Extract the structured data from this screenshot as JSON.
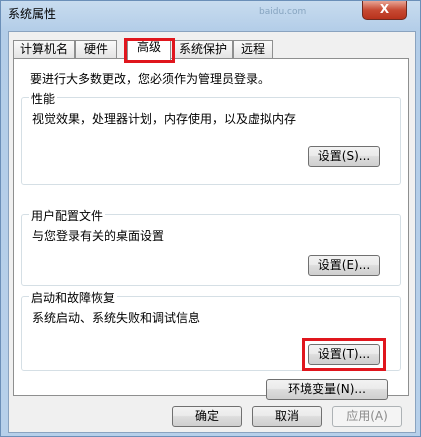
{
  "window": {
    "title": "系统属性",
    "close_label": "X",
    "watermark": "baidu.com"
  },
  "tabs": [
    {
      "label": "计算机名",
      "active": false
    },
    {
      "label": "硬件",
      "active": false
    },
    {
      "label": "高级",
      "active": true
    },
    {
      "label": "系统保护",
      "active": false
    },
    {
      "label": "远程",
      "active": false
    }
  ],
  "advanced": {
    "admin_note": "要进行大多数更改，您必须作为管理员登录。",
    "performance": {
      "title": "性能",
      "description": "视觉效果，处理器计划，内存使用，以及虚拟内存",
      "button": "设置(S)..."
    },
    "user_profiles": {
      "title": "用户配置文件",
      "description": "与您登录有关的桌面设置",
      "button": "设置(E)..."
    },
    "startup_recovery": {
      "title": "启动和故障恢复",
      "description": "系统启动、系统失败和调试信息",
      "button": "设置(T)..."
    },
    "env_button": "环境变量(N)..."
  },
  "footer": {
    "ok": "确定",
    "cancel": "取消",
    "apply": "应用(A)"
  },
  "colors": {
    "highlight": "#e0161d",
    "titlebar": "#b7d0ea"
  }
}
